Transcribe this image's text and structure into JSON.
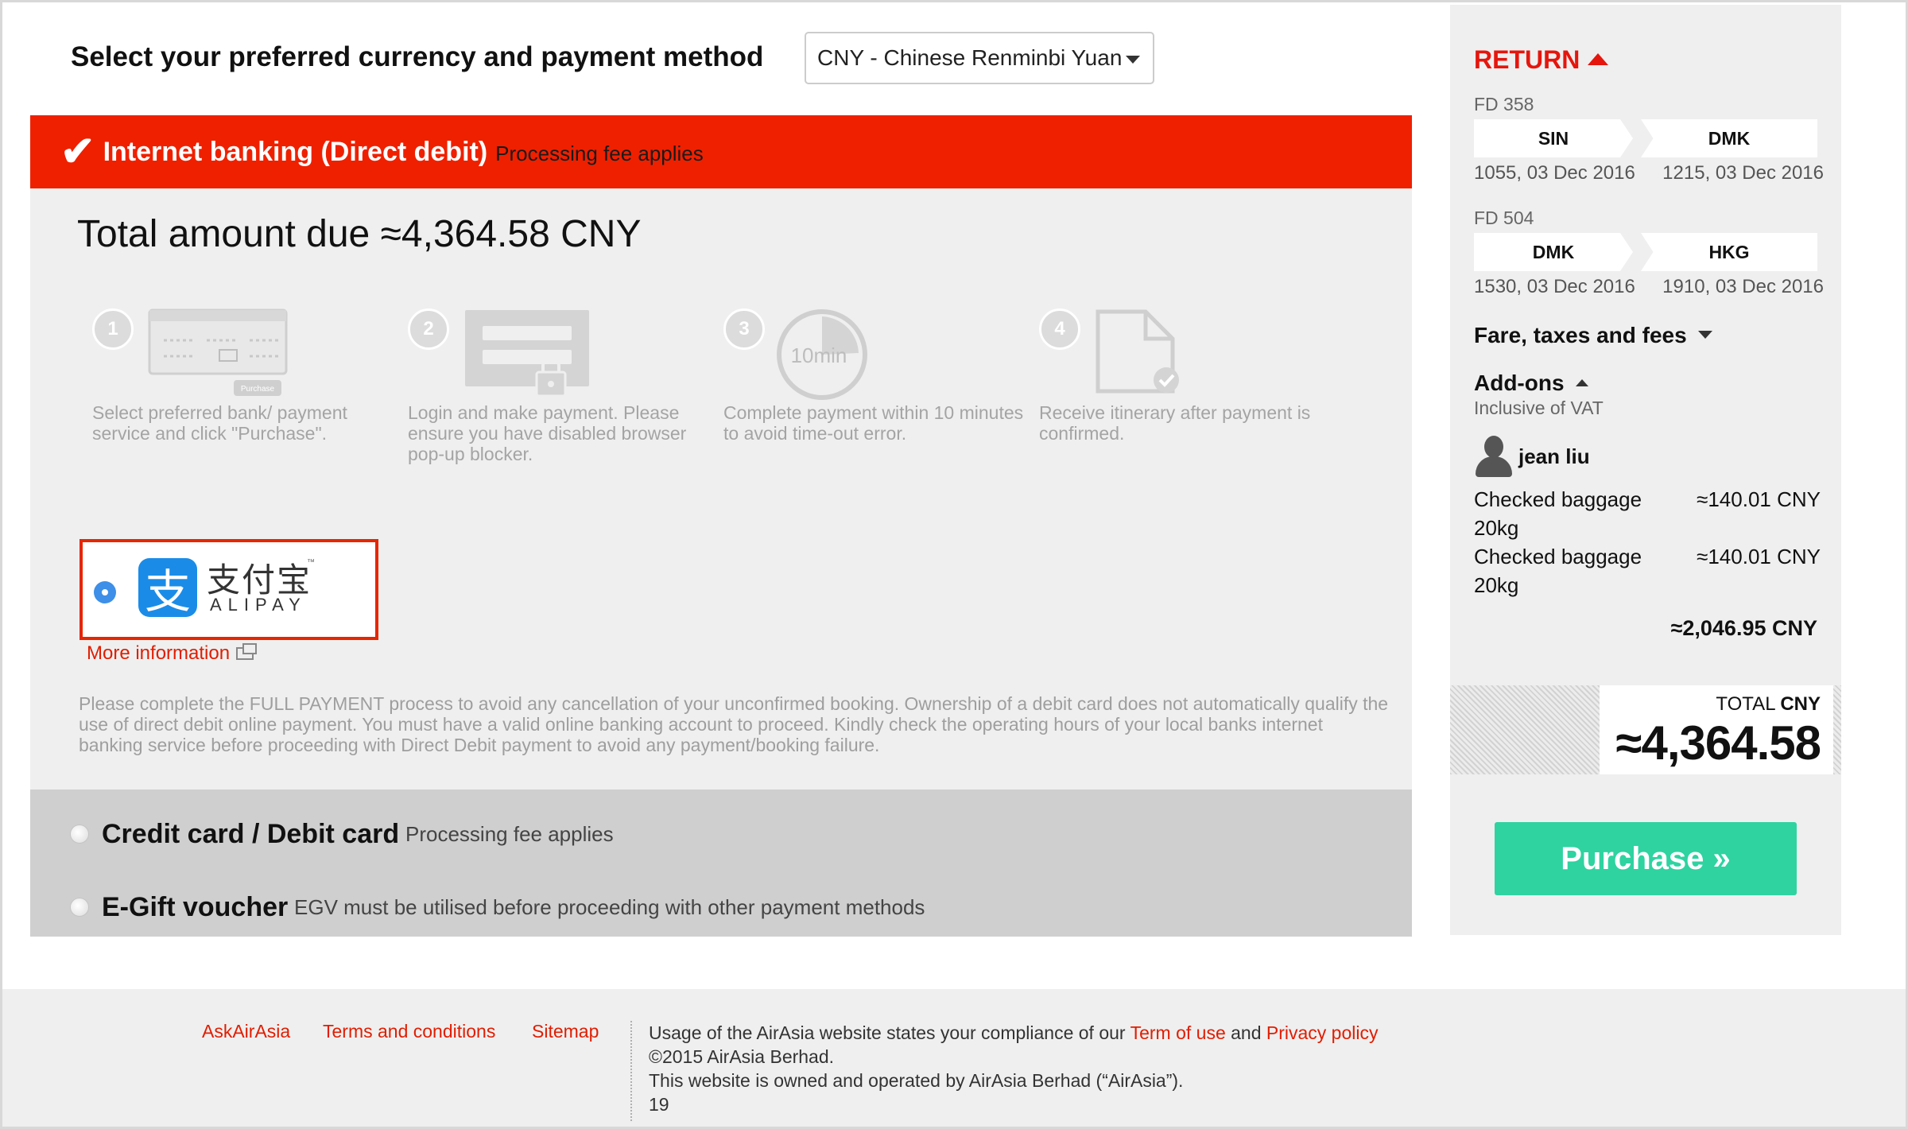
{
  "header": {
    "title": "Select your preferred currency and payment method",
    "currency_selected": "CNY - Chinese Renminbi Yuan"
  },
  "banner": {
    "label": "Internet banking (Direct debit)",
    "fee_note": "Processing fee applies"
  },
  "total_amount": "Total amount due ≈4,364.58 CNY",
  "steps": [
    {
      "num": "1",
      "text": "Select preferred bank/ payment service and click \"Purchase\".",
      "graphic_label": "Purchase"
    },
    {
      "num": "2",
      "text": "Login and make payment. Please ensure you have disabled browser pop-up blocker."
    },
    {
      "num": "3",
      "text": "Complete payment within 10 minutes to avoid time-out error.",
      "graphic_label": "10min"
    },
    {
      "num": "4",
      "text": "Receive itinerary after payment is confirmed."
    }
  ],
  "alipay": {
    "cn": "支付宝",
    "en": "ALIPAY",
    "tm": "™",
    "logo_glyph": "支",
    "more_info": "More information"
  },
  "notice": "Please complete the FULL PAYMENT process to avoid any cancellation of your unconfirmed booking. Ownership of a debit card does not automatically qualify the use of direct debit online payment. You must have a valid online banking account to proceed. Kindly check the operating hours of your local banks internet banking service before proceeding with Direct Debit payment to avoid any payment/booking failure.",
  "alt_methods": [
    {
      "name": "Credit card / Debit card",
      "sub": "Processing fee applies"
    },
    {
      "name": "E-Gift voucher",
      "sub": "EGV must be utilised before proceeding with other payment methods"
    }
  ],
  "sidebar": {
    "return_label": "RETURN",
    "flights": [
      {
        "flight_no": "FD 358",
        "from": "SIN",
        "to": "DMK",
        "depart": "1055, 03 Dec 2016",
        "arrive": "1215, 03 Dec 2016"
      },
      {
        "flight_no": "FD 504",
        "from": "DMK",
        "to": "HKG",
        "depart": "1530, 03 Dec 2016",
        "arrive": "1910, 03 Dec 2016"
      }
    ],
    "fare_label": "Fare, taxes and fees",
    "addons_label": "Add-ons",
    "vat_note": "Inclusive of VAT",
    "passenger": "jean liu",
    "baggage": [
      {
        "line1": "Checked baggage",
        "line2": "20kg",
        "amount": "≈140.01 CNY"
      },
      {
        "line1": "Checked baggage",
        "line2": "20kg",
        "amount": "≈140.01 CNY"
      }
    ],
    "addons_total": "≈2,046.95 CNY",
    "total_label": "TOTAL",
    "total_currency": "CNY",
    "total_value": "≈4,364.58",
    "purchase_label": "Purchase »"
  },
  "footer": {
    "links": [
      "AskAirAsia",
      "Terms and conditions",
      "Sitemap"
    ],
    "legal_prefix": "Usage of the AirAsia website states your compliance of our",
    "term_of_use": "Term of use",
    "and": "and",
    "privacy": "Privacy policy",
    "copyright": "©2015 AirAsia Berhad.",
    "owned": "This website is owned and operated by AirAsia Berhad (“AirAsia”).",
    "page_num": "19"
  },
  "colors": {
    "brand_red": "#ef2000",
    "purchase_green": "#2ed3a0",
    "alipay_blue": "#1a8ce8"
  }
}
